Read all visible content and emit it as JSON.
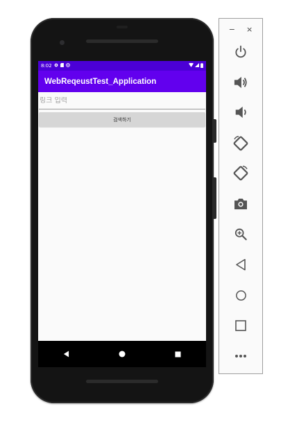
{
  "status_bar": {
    "time": "8:02"
  },
  "app_bar": {
    "title": "WebReqeustTest_Application"
  },
  "link_input": {
    "placeholder": "링크 입력",
    "value": ""
  },
  "search_button": {
    "label": "검색하기"
  },
  "nav_bar": {
    "back": "back-icon",
    "home": "home-icon",
    "recents": "recents-icon"
  },
  "emulator_panel": {
    "window_controls": {
      "minimize": "−",
      "close": "×"
    },
    "tools": [
      "power-icon",
      "volume-up-icon",
      "volume-down-icon",
      "rotate-left-icon",
      "rotate-right-icon",
      "camera-icon",
      "zoom-icon",
      "back-icon",
      "home-icon",
      "overview-icon",
      "more-icon"
    ]
  },
  "colors": {
    "primary": "#6200ee",
    "primary_dark": "#4b00d6",
    "button_bg": "#d6d6d6",
    "phone_body": "#141414",
    "panel_icon": "#555555"
  }
}
